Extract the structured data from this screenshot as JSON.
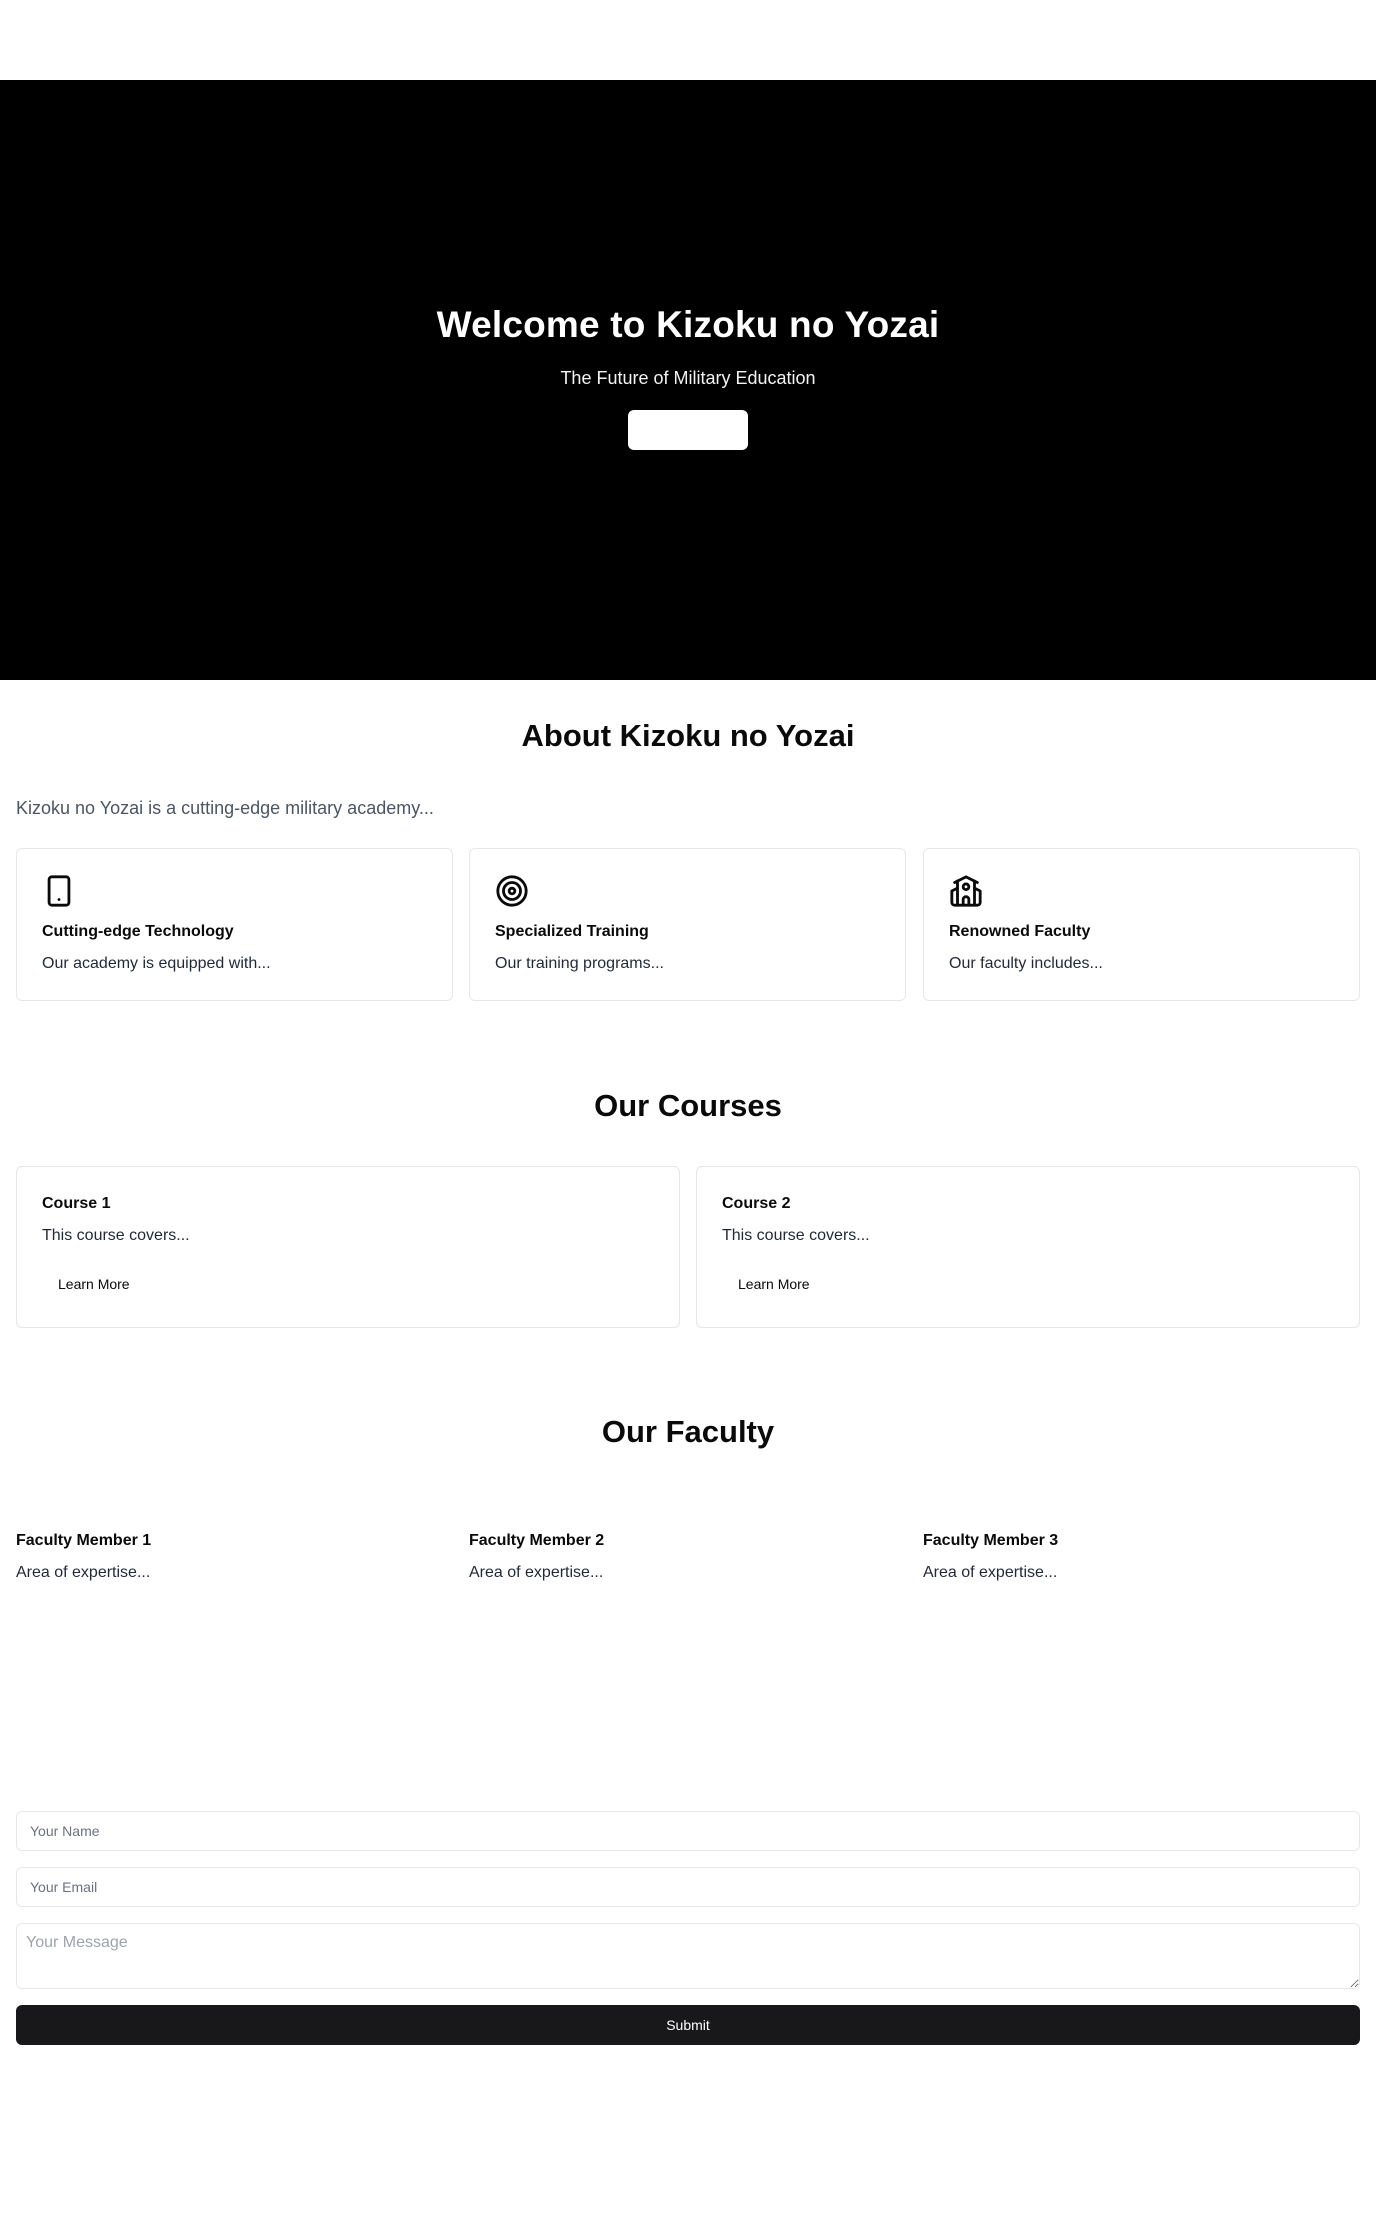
{
  "hero": {
    "title": "Welcome to Kizoku no Yozai",
    "subtitle": "The Future of Military Education",
    "button_label": ""
  },
  "about": {
    "title": "About Kizoku no Yozai",
    "text": "Kizoku no Yozai is a cutting-edge military academy...",
    "features": [
      {
        "icon": "tablet-icon",
        "heading": "Cutting-edge Technology",
        "body": "Our academy is equipped with..."
      },
      {
        "icon": "target-icon",
        "heading": "Specialized Training",
        "body": "Our training programs..."
      },
      {
        "icon": "school-building-icon",
        "heading": "Renowned Faculty",
        "body": "Our faculty includes..."
      }
    ]
  },
  "courses": {
    "title": "Our Courses",
    "items": [
      {
        "heading": "Course 1",
        "body": "This course covers...",
        "button_label": "Learn More"
      },
      {
        "heading": "Course 2",
        "body": "This course covers...",
        "button_label": "Learn More"
      }
    ]
  },
  "faculty": {
    "title": "Our Faculty",
    "members": [
      {
        "name": "Faculty Member 1",
        "area": "Area of expertise..."
      },
      {
        "name": "Faculty Member 2",
        "area": "Area of expertise..."
      },
      {
        "name": "Faculty Member 3",
        "area": "Area of expertise..."
      }
    ]
  },
  "contact": {
    "name_placeholder": "Your Name",
    "email_placeholder": "Your Email",
    "message_placeholder": "Your Message",
    "submit_label": "Submit"
  },
  "colors": {
    "hero_background": "#000000",
    "submit_background": "#18181b",
    "card_border": "#e5e7eb"
  }
}
